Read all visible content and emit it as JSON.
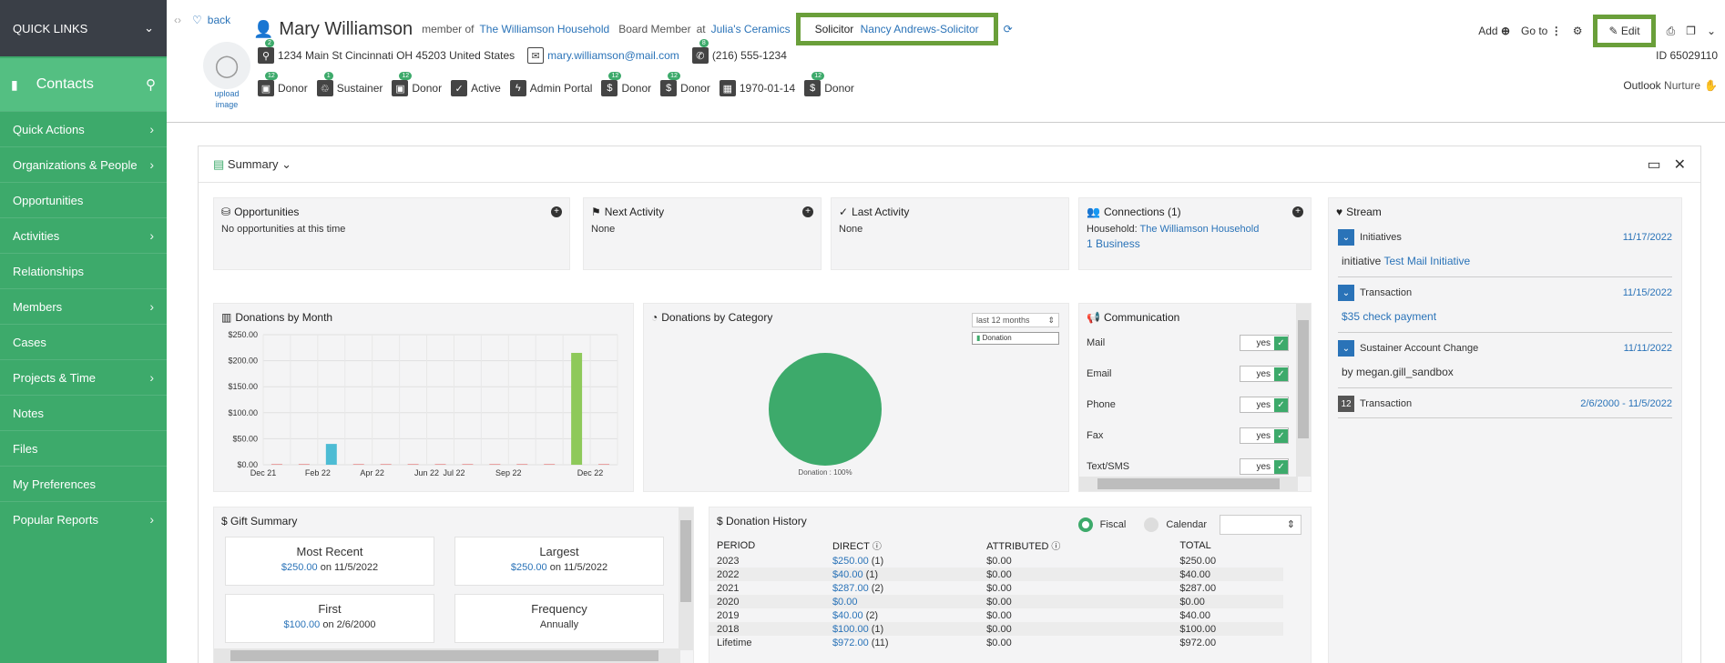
{
  "sidebar": {
    "quick_links": "QUICK LINKS",
    "module": "Contacts",
    "items": [
      {
        "label": "Quick Actions",
        "has_children": true
      },
      {
        "label": "Organizations & People",
        "has_children": true
      },
      {
        "label": "Opportunities",
        "has_children": false
      },
      {
        "label": "Activities",
        "has_children": true
      },
      {
        "label": "Relationships",
        "has_children": false
      },
      {
        "label": "Members",
        "has_children": true
      },
      {
        "label": "Cases",
        "has_children": false
      },
      {
        "label": "Projects & Time",
        "has_children": true
      },
      {
        "label": "Notes",
        "has_children": false
      },
      {
        "label": "Files",
        "has_children": false
      },
      {
        "label": "My Preferences",
        "has_children": false
      },
      {
        "label": "Popular Reports",
        "has_children": true
      }
    ]
  },
  "header": {
    "back": "back",
    "name": "Mary Williamson",
    "member_of_label": "member of",
    "household": "The Williamson Household",
    "board_label": "Board Member",
    "at_label": "at",
    "employer": "Julia's Ceramics",
    "solicitor_label": "Solicitor",
    "solicitor": "Nancy Andrews-Solicitor",
    "upload_image": "upload image",
    "address": "1234 Main St Cincinnati  OH 45203  United States",
    "email": "mary.williamson@mail.com",
    "phone": "(216) 555-1234",
    "address_badge": "2",
    "phone_badge": "8",
    "tags": [
      {
        "icon": "donor-icon",
        "label": "Donor",
        "badge": "12"
      },
      {
        "icon": "recycle-icon",
        "label": "Sustainer",
        "badge": "1"
      },
      {
        "icon": "donor-icon",
        "label": "Donor",
        "badge": "12"
      },
      {
        "icon": "check-icon",
        "label": "Active",
        "badge": ""
      },
      {
        "icon": "bolt-icon",
        "label": "Admin Portal",
        "badge": ""
      },
      {
        "icon": "dollar-icon",
        "label": "Donor",
        "badge": "12"
      },
      {
        "icon": "dollar-icon",
        "label": "Donor",
        "badge": "12"
      },
      {
        "icon": "calendar-icon",
        "label": "1970-01-14",
        "badge": ""
      },
      {
        "icon": "dollar-icon",
        "label": "Donor",
        "badge": "12"
      }
    ],
    "add": "Add",
    "goto": "Go to",
    "edit": "Edit",
    "id": "ID 65029110",
    "outlook_label": "Outlook",
    "outlook_value": "Nurture"
  },
  "summary": {
    "title": "Summary",
    "opportunities": {
      "title": "Opportunities",
      "text": "No opportunities at this time"
    },
    "next_activity": {
      "title": "Next Activity",
      "text": "None"
    },
    "last_activity": {
      "title": "Last Activity",
      "text": "None"
    },
    "connections": {
      "title": "Connections (1)",
      "household_label": "Household:",
      "household": "The Williamson Household",
      "business": "1 Business"
    },
    "stream": {
      "title": "Stream",
      "items": [
        {
          "toggle": "⌄",
          "title": "Initiatives",
          "date": "11/17/2022",
          "body_prefix": "initiative",
          "body_link": "Test Mail Initiative"
        },
        {
          "toggle": "⌄",
          "title": "Transaction",
          "date": "11/15/2022",
          "body_prefix": "",
          "body_link": "$35 check payment"
        },
        {
          "toggle": "⌄",
          "title": "Sustainer Account Change",
          "date": "11/11/2022",
          "body_prefix": "by megan.gill_sandbox",
          "body_link": ""
        },
        {
          "toggle": "12",
          "title": "Transaction",
          "date": "2/6/2000 - 11/5/2022",
          "body_prefix": "",
          "body_link": ""
        }
      ]
    },
    "communication": {
      "title": "Communication",
      "rows": [
        {
          "label": "Mail",
          "value": "yes"
        },
        {
          "label": "Email",
          "value": "yes"
        },
        {
          "label": "Phone",
          "value": "yes"
        },
        {
          "label": "Fax",
          "value": "yes"
        },
        {
          "label": "Text/SMS",
          "value": "yes"
        }
      ]
    },
    "gift_summary": {
      "title": "$ Gift Summary",
      "most_recent": {
        "title": "Most Recent",
        "amount": "$250.00",
        "on": "on 11/5/2022"
      },
      "largest": {
        "title": "Largest",
        "amount": "$250.00",
        "on": "on 11/5/2022"
      },
      "first": {
        "title": "First",
        "amount": "$100.00",
        "on": "on 2/6/2000"
      },
      "frequency": {
        "title": "Frequency",
        "value": "Annually"
      }
    },
    "donation_history": {
      "title": "$ Donation History",
      "fiscal": "Fiscal",
      "calendar": "Calendar",
      "columns": [
        "PERIOD",
        "DIRECT",
        "ATTRIBUTED",
        "TOTAL"
      ],
      "rows": [
        {
          "period": "2023",
          "direct": "$250.00",
          "count": "(1)",
          "attributed": "$0.00",
          "total": "$250.00"
        },
        {
          "period": "2022",
          "direct": "$40.00",
          "count": "(1)",
          "attributed": "$0.00",
          "total": "$40.00"
        },
        {
          "period": "2021",
          "direct": "$287.00",
          "count": "(2)",
          "attributed": "$0.00",
          "total": "$287.00"
        },
        {
          "period": "2020",
          "direct": "$0.00",
          "count": "",
          "attributed": "$0.00",
          "total": "$0.00"
        },
        {
          "period": "2019",
          "direct": "$40.00",
          "count": "(2)",
          "attributed": "$0.00",
          "total": "$40.00"
        },
        {
          "period": "2018",
          "direct": "$100.00",
          "count": "(1)",
          "attributed": "$0.00",
          "total": "$100.00"
        },
        {
          "period": "Lifetime",
          "direct": "$972.00",
          "count": "(11)",
          "attributed": "$0.00",
          "total": "$972.00"
        }
      ]
    }
  },
  "chart_data": [
    {
      "type": "bar",
      "title": "Donations by Month",
      "x_tick_labels": [
        "Dec 21",
        "Feb 22",
        "Apr 22",
        "Jun 22",
        "Jul 22",
        "Sep 22",
        "Dec 22"
      ],
      "categories": [
        "Dec 21",
        "Jan 22",
        "Feb 22",
        "Mar 22",
        "Apr 22",
        "May 22",
        "Jun 22",
        "Jul 22",
        "Aug 22",
        "Sep 22",
        "Oct 22",
        "Nov 22",
        "Dec 22"
      ],
      "values": [
        0,
        0,
        40,
        0,
        0,
        0,
        0,
        0,
        0,
        0,
        0,
        215,
        0
      ],
      "colors": [
        "#4dbcd4",
        "#4dbcd4",
        "#4dbcd4",
        "#4dbcd4",
        "#4dbcd4",
        "#4dbcd4",
        "#4dbcd4",
        "#4dbcd4",
        "#4dbcd4",
        "#4dbcd4",
        "#4dbcd4",
        "#8ec95a",
        "#4dbcd4"
      ],
      "y_tick_labels": [
        "$250.00",
        "$200.00",
        "$150.00",
        "$100.00",
        "$50.00",
        "$0.00"
      ],
      "ylim": [
        0,
        250
      ],
      "grid": true
    },
    {
      "type": "pie",
      "title": "Donations by Category",
      "range_select": "last 12 months",
      "legend": [
        "Donation"
      ],
      "slices": [
        {
          "label": "Donation",
          "value": 100,
          "color": "#3daa6b"
        }
      ],
      "data_label": "Donation : 100%"
    }
  ]
}
